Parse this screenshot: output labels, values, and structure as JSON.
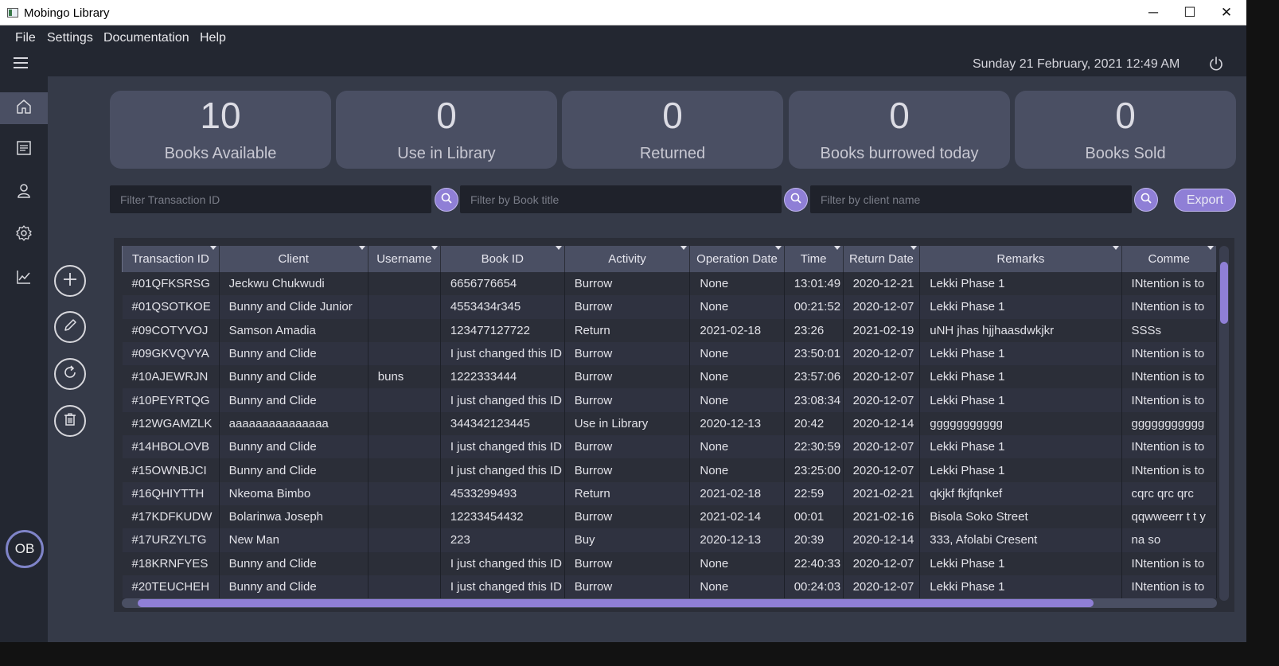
{
  "window": {
    "title": "Mobingo Library",
    "minimize": "─",
    "maximize": "☐",
    "close": "✕"
  },
  "menu": [
    "File",
    "Settings",
    "Documentation",
    "Help"
  ],
  "datetime": "Sunday 21 February, 2021 12:49 AM",
  "user": {
    "initials": "OB"
  },
  "stats": [
    {
      "value": "10",
      "label": "Books Available"
    },
    {
      "value": "0",
      "label": "Use in Library"
    },
    {
      "value": "0",
      "label": "Returned"
    },
    {
      "value": "0",
      "label": "Books burrowed today"
    },
    {
      "value": "0",
      "label": "Books Sold"
    }
  ],
  "filters": {
    "transaction_placeholder": "Filter Transaction ID",
    "book_placeholder": "Filter by Book title",
    "client_placeholder": "Filter by client name",
    "export_label": "Export"
  },
  "table": {
    "columns": [
      "Transaction ID",
      "Client",
      "Username",
      "Book ID",
      "Activity",
      "Operation Date",
      "Time",
      "Return Date",
      "Remarks",
      "Comme"
    ],
    "rows": [
      [
        "#01QFKSRSG",
        "Jeckwu Chukwudi",
        "",
        "6656776654",
        "Burrow",
        "None",
        "13:01:49",
        "2020-12-21",
        "Lekki Phase 1",
        "INtention is to"
      ],
      [
        "#01QSOTKOE",
        "Bunny and Clide Junior",
        "",
        "4553434r345",
        "Burrow",
        "None",
        "00:21:52",
        "2020-12-07",
        "Lekki Phase 1",
        "INtention is to"
      ],
      [
        "#09COTYVOJ",
        "Samson Amadia",
        "",
        "123477127722",
        "Return",
        "2021-02-18",
        "23:26",
        "2021-02-19",
        "uNH jhas hjjhaasdwkjkr",
        "SSSs"
      ],
      [
        "#09GKVQVYA",
        "Bunny and Clide",
        "",
        "I just changed this ID",
        "Burrow",
        "None",
        "23:50:01",
        "2020-12-07",
        "Lekki Phase 1",
        "INtention is to"
      ],
      [
        "#10AJEWRJN",
        "Bunny and Clide",
        "buns",
        "1222333444",
        "Burrow",
        "None",
        "23:57:06",
        "2020-12-07",
        "Lekki Phase 1",
        "INtention is to"
      ],
      [
        "#10PEYRTQG",
        "Bunny and Clide",
        "",
        "I just changed this ID",
        "Burrow",
        "None",
        "23:08:34",
        "2020-12-07",
        "Lekki Phase 1",
        "INtention is to"
      ],
      [
        "#12WGAMZLK",
        "aaaaaaaaaaaaaaa",
        "",
        "344342123445",
        "Use in Library",
        "2020-12-13",
        "20:42",
        "2020-12-14",
        "ggggggggggg",
        "ggggggggggg"
      ],
      [
        "#14HBOLOVB",
        "Bunny and Clide",
        "",
        "I just changed this ID",
        "Burrow",
        "None",
        "22:30:59",
        "2020-12-07",
        "Lekki Phase 1",
        "INtention is to"
      ],
      [
        "#15OWNBJCI",
        "Bunny and Clide",
        "",
        "I just changed this ID",
        "Burrow",
        "None",
        "23:25:00",
        "2020-12-07",
        "Lekki Phase 1",
        "INtention is to"
      ],
      [
        "#16QHIYTTH",
        "Nkeoma Bimbo",
        "",
        "4533299493",
        "Return",
        "2021-02-18",
        "22:59",
        "2021-02-21",
        "qkjkf fkjfqnkef",
        "cqrc qrc qrc"
      ],
      [
        "#17KDFKUDW",
        "Bolarinwa Joseph",
        "",
        "12233454432",
        "Burrow",
        "2021-02-14",
        "00:01",
        "2021-02-16",
        "Bisola Soko Street",
        "qqwweerr t  t  y"
      ],
      [
        "#17URZYLTG",
        "New Man",
        "",
        "223",
        "Buy",
        "2020-12-13",
        "20:39",
        "2020-12-14",
        "333, Afolabi Cresent",
        "na so"
      ],
      [
        "#18KRNFYES",
        "Bunny and Clide",
        "",
        "I just changed this ID",
        "Burrow",
        "None",
        "22:40:33",
        "2020-12-07",
        "Lekki Phase 1",
        "INtention is to"
      ],
      [
        "#20TEUCHEH",
        "Bunny and Clide",
        "",
        "I just changed this ID",
        "Burrow",
        "None",
        "00:24:03",
        "2020-12-07",
        "Lekki Phase 1",
        "INtention is to"
      ]
    ]
  },
  "colors": {
    "accent": "#8f7fd6",
    "card": "#4a4f63",
    "background": "#353a48"
  }
}
